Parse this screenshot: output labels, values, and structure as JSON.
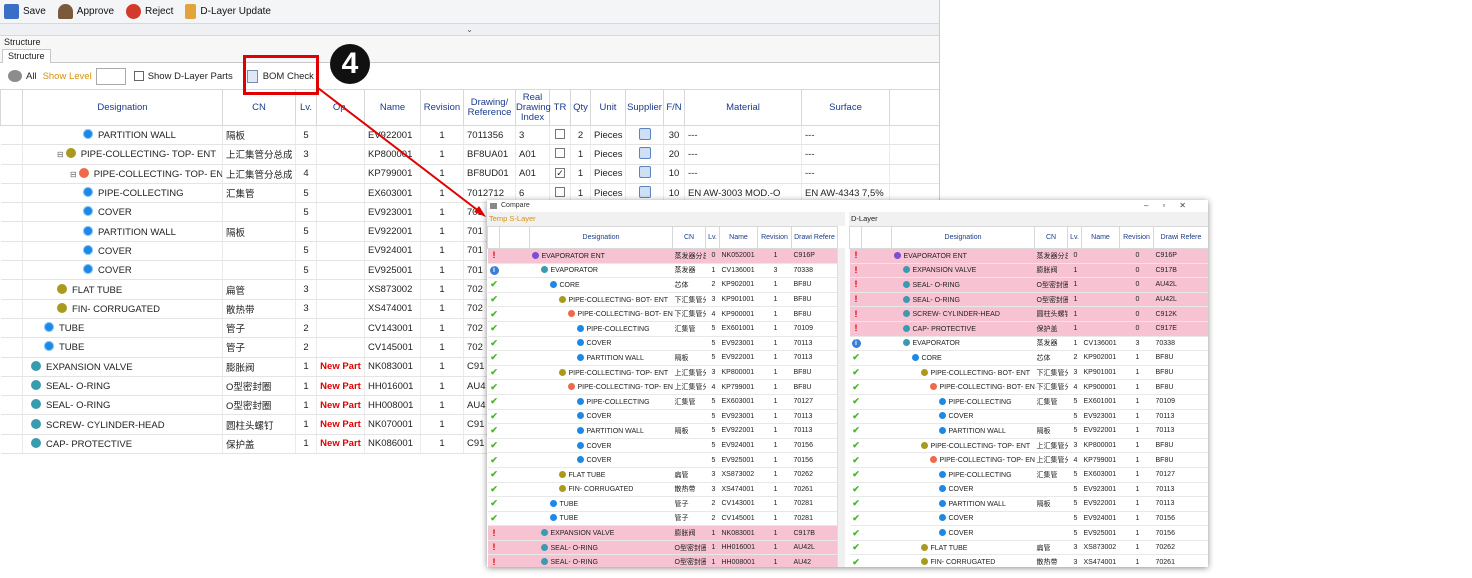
{
  "toolbar": {
    "save": "Save",
    "approve": "Approve",
    "reject": "Reject",
    "dlayer_update": "D-Layer Update"
  },
  "section_label": "Structure",
  "tab_structure": "Structure",
  "filters": {
    "all": "All",
    "show_level": "Show Level",
    "show_dlayer": "Show D-Layer Parts",
    "bom_check": "BOM Check"
  },
  "step_badge": "4",
  "main_columns": [
    "Designation",
    "CN",
    "Lv.",
    "Op.",
    "Name",
    "Revision",
    "Drawing/ Reference",
    "Real Drawing Index",
    "TR",
    "Qty",
    "Unit",
    "Supplier",
    "F/N",
    "Material",
    "Surface"
  ],
  "main_rows": [
    {
      "indent": 4,
      "pm": "",
      "icon": "blue",
      "des": "PARTITION WALL",
      "cn": "隔板",
      "lv": "5",
      "op": "",
      "name": "EV922001",
      "rev": "1",
      "draw": "7011356",
      "idx": "3",
      "tr": "empty",
      "qty": "2",
      "unit": "Pieces",
      "sup": true,
      "fn": "30",
      "mat": "---",
      "surf": "---"
    },
    {
      "indent": 2,
      "pm": "⊟",
      "icon": "olive",
      "des": "PIPE-COLLECTING- TOP- ENT",
      "cn": "上汇集管分总成",
      "lv": "3",
      "op": "",
      "name": "KP800001",
      "rev": "1",
      "draw": "BF8UA01",
      "idx": "A01",
      "tr": "empty",
      "qty": "1",
      "unit": "Pieces",
      "sup": true,
      "fn": "20",
      "mat": "---",
      "surf": "---"
    },
    {
      "indent": 3,
      "pm": "⊟",
      "icon": "red",
      "des": "PIPE-COLLECTING- TOP- ENT",
      "cn": "上汇集管分总成",
      "lv": "4",
      "op": "",
      "name": "KP799001",
      "rev": "1",
      "draw": "BF8UD01",
      "idx": "A01",
      "tr": "checked",
      "qty": "1",
      "unit": "Pieces",
      "sup": true,
      "fn": "10",
      "mat": "---",
      "surf": "---"
    },
    {
      "indent": 4,
      "pm": "",
      "icon": "blue",
      "des": "PIPE-COLLECTING",
      "cn": "汇集管",
      "lv": "5",
      "op": "",
      "name": "EX603001",
      "rev": "1",
      "draw": "7012712",
      "idx": "6",
      "tr": "empty",
      "qty": "1",
      "unit": "Pieces",
      "sup": true,
      "fn": "10",
      "mat": "EN AW-3003 MOD.-O",
      "surf": "EN AW-4343 7,5%"
    },
    {
      "indent": 4,
      "pm": "",
      "icon": "blue",
      "des": "COVER",
      "cn": "",
      "lv": "5",
      "op": "",
      "name": "EV923001",
      "rev": "1",
      "draw": "701",
      "idx": "",
      "tr": "",
      "qty": "",
      "unit": "",
      "sup": false,
      "fn": "",
      "mat": "",
      "surf": ""
    },
    {
      "indent": 4,
      "pm": "",
      "icon": "blue",
      "des": "PARTITION WALL",
      "cn": "隔板",
      "lv": "5",
      "op": "",
      "name": "EV922001",
      "rev": "1",
      "draw": "701",
      "idx": "",
      "tr": "",
      "qty": "",
      "unit": "",
      "sup": false,
      "fn": "",
      "mat": "",
      "surf": ""
    },
    {
      "indent": 4,
      "pm": "",
      "icon": "blue",
      "des": "COVER",
      "cn": "",
      "lv": "5",
      "op": "",
      "name": "EV924001",
      "rev": "1",
      "draw": "701",
      "idx": "",
      "tr": "",
      "qty": "",
      "unit": "",
      "sup": false,
      "fn": "",
      "mat": "",
      "surf": ""
    },
    {
      "indent": 4,
      "pm": "",
      "icon": "blue",
      "des": "COVER",
      "cn": "",
      "lv": "5",
      "op": "",
      "name": "EV925001",
      "rev": "1",
      "draw": "701",
      "idx": "",
      "tr": "",
      "qty": "",
      "unit": "",
      "sup": false,
      "fn": "",
      "mat": "",
      "surf": ""
    },
    {
      "indent": 2,
      "pm": "",
      "icon": "olive",
      "des": "FLAT TUBE",
      "cn": "扁管",
      "lv": "3",
      "op": "",
      "name": "XS873002",
      "rev": "1",
      "draw": "702",
      "idx": "",
      "tr": "",
      "qty": "",
      "unit": "",
      "sup": false,
      "fn": "",
      "mat": "",
      "surf": ""
    },
    {
      "indent": 2,
      "pm": "",
      "icon": "olive",
      "des": "FIN- CORRUGATED",
      "cn": "散热带",
      "lv": "3",
      "op": "",
      "name": "XS474001",
      "rev": "1",
      "draw": "702",
      "idx": "",
      "tr": "",
      "qty": "",
      "unit": "",
      "sup": false,
      "fn": "",
      "mat": "",
      "surf": ""
    },
    {
      "indent": 1,
      "pm": "",
      "icon": "blue",
      "des": "TUBE",
      "cn": "管子",
      "lv": "2",
      "op": "",
      "name": "CV143001",
      "rev": "1",
      "draw": "702",
      "idx": "",
      "tr": "",
      "qty": "",
      "unit": "",
      "sup": false,
      "fn": "",
      "mat": "",
      "surf": ""
    },
    {
      "indent": 1,
      "pm": "",
      "icon": "blue",
      "des": "TUBE",
      "cn": "管子",
      "lv": "2",
      "op": "",
      "name": "CV145001",
      "rev": "1",
      "draw": "702",
      "idx": "",
      "tr": "",
      "qty": "",
      "unit": "",
      "sup": false,
      "fn": "",
      "mat": "",
      "surf": ""
    },
    {
      "indent": 0,
      "pm": "",
      "icon": "teal",
      "des": "EXPANSION VALVE",
      "cn": "膨胀阀",
      "lv": "1",
      "op": "New Part",
      "name": "NK083001",
      "rev": "1",
      "draw": "C91",
      "idx": "",
      "tr": "",
      "qty": "",
      "unit": "",
      "sup": false,
      "fn": "",
      "mat": "",
      "surf": ""
    },
    {
      "indent": 0,
      "pm": "",
      "icon": "teal",
      "des": "SEAL- O-RING",
      "cn": "O型密封圈",
      "lv": "1",
      "op": "New Part",
      "name": "HH016001",
      "rev": "1",
      "draw": "AU4",
      "idx": "",
      "tr": "",
      "qty": "",
      "unit": "",
      "sup": false,
      "fn": "",
      "mat": "",
      "surf": ""
    },
    {
      "indent": 0,
      "pm": "",
      "icon": "teal",
      "des": "SEAL- O-RING",
      "cn": "O型密封圈",
      "lv": "1",
      "op": "New Part",
      "name": "HH008001",
      "rev": "1",
      "draw": "AU4",
      "idx": "",
      "tr": "",
      "qty": "",
      "unit": "",
      "sup": false,
      "fn": "",
      "mat": "",
      "surf": ""
    },
    {
      "indent": 0,
      "pm": "",
      "icon": "teal",
      "des": "SCREW- CYLINDER-HEAD",
      "cn": "圆柱头螺钉",
      "lv": "1",
      "op": "New Part",
      "name": "NK070001",
      "rev": "1",
      "draw": "C91",
      "idx": "",
      "tr": "",
      "qty": "",
      "unit": "",
      "sup": false,
      "fn": "",
      "mat": "",
      "surf": ""
    },
    {
      "indent": 0,
      "pm": "",
      "icon": "teal",
      "des": "CAP- PROTECTIVE",
      "cn": "保护盖",
      "lv": "1",
      "op": "New Part",
      "name": "NK086001",
      "rev": "1",
      "draw": "C91",
      "idx": "",
      "tr": "",
      "qty": "",
      "unit": "",
      "sup": false,
      "fn": "",
      "mat": "",
      "surf": ""
    }
  ],
  "compare": {
    "window_title": "Compare",
    "left_label": "Temp S-Layer",
    "right_label": "D-Layer",
    "columns": [
      "Designation",
      "CN",
      "Lv.",
      "Name",
      "Revision",
      "Drawi Refere"
    ],
    "left_rows": [
      {
        "st": "bad",
        "pink": true,
        "indent": 0,
        "icon": "purple",
        "des": "EVAPORATOR ENT",
        "cn": "蒸发器分总成",
        "lv": "0",
        "name": "NK052001",
        "rev": "1",
        "draw": "C916P"
      },
      {
        "st": "info",
        "pink": false,
        "indent": 1,
        "icon": "teal",
        "des": "EVAPORATOR",
        "cn": "蒸发器",
        "lv": "1",
        "name": "CV136001",
        "rev": "3",
        "draw": "70338"
      },
      {
        "st": "ok",
        "pink": false,
        "indent": 2,
        "icon": "blue",
        "des": "CORE",
        "cn": "芯体",
        "lv": "2",
        "name": "KP902001",
        "rev": "1",
        "draw": "BF8U"
      },
      {
        "st": "ok",
        "pink": false,
        "indent": 3,
        "icon": "olive",
        "des": "PIPE-COLLECTING- BOT- ENT",
        "cn": "下汇集管分总成",
        "lv": "3",
        "name": "KP901001",
        "rev": "1",
        "draw": "BF8U"
      },
      {
        "st": "ok",
        "pink": false,
        "indent": 4,
        "icon": "red",
        "des": "PIPE-COLLECTING- BOT- ENT",
        "cn": "下汇集管分总成",
        "lv": "4",
        "name": "KP900001",
        "rev": "1",
        "draw": "BF8U"
      },
      {
        "st": "ok",
        "pink": false,
        "indent": 5,
        "icon": "blue",
        "des": "PIPE-COLLECTING",
        "cn": "汇集管",
        "lv": "5",
        "name": "EX601001",
        "rev": "1",
        "draw": "70109"
      },
      {
        "st": "ok",
        "pink": false,
        "indent": 5,
        "icon": "blue",
        "des": "COVER",
        "cn": "",
        "lv": "5",
        "name": "EV923001",
        "rev": "1",
        "draw": "70113"
      },
      {
        "st": "ok",
        "pink": false,
        "indent": 5,
        "icon": "blue",
        "des": "PARTITION WALL",
        "cn": "隔板",
        "lv": "5",
        "name": "EV922001",
        "rev": "1",
        "draw": "70113"
      },
      {
        "st": "ok",
        "pink": false,
        "indent": 3,
        "icon": "olive",
        "des": "PIPE-COLLECTING- TOP- ENT",
        "cn": "上汇集管分总成",
        "lv": "3",
        "name": "KP800001",
        "rev": "1",
        "draw": "BF8U"
      },
      {
        "st": "ok",
        "pink": false,
        "indent": 4,
        "icon": "red",
        "des": "PIPE-COLLECTING- TOP- ENT",
        "cn": "上汇集管分总成",
        "lv": "4",
        "name": "KP799001",
        "rev": "1",
        "draw": "BF8U"
      },
      {
        "st": "ok",
        "pink": false,
        "indent": 5,
        "icon": "blue",
        "des": "PIPE-COLLECTING",
        "cn": "汇集管",
        "lv": "5",
        "name": "EX603001",
        "rev": "1",
        "draw": "70127"
      },
      {
        "st": "ok",
        "pink": false,
        "indent": 5,
        "icon": "blue",
        "des": "COVER",
        "cn": "",
        "lv": "5",
        "name": "EV923001",
        "rev": "1",
        "draw": "70113"
      },
      {
        "st": "ok",
        "pink": false,
        "indent": 5,
        "icon": "blue",
        "des": "PARTITION WALL",
        "cn": "隔板",
        "lv": "5",
        "name": "EV922001",
        "rev": "1",
        "draw": "70113"
      },
      {
        "st": "ok",
        "pink": false,
        "indent": 5,
        "icon": "blue",
        "des": "COVER",
        "cn": "",
        "lv": "5",
        "name": "EV924001",
        "rev": "1",
        "draw": "70156"
      },
      {
        "st": "ok",
        "pink": false,
        "indent": 5,
        "icon": "blue",
        "des": "COVER",
        "cn": "",
        "lv": "5",
        "name": "EV925001",
        "rev": "1",
        "draw": "70156"
      },
      {
        "st": "ok",
        "pink": false,
        "indent": 3,
        "icon": "olive",
        "des": "FLAT TUBE",
        "cn": "扁管",
        "lv": "3",
        "name": "XS873002",
        "rev": "1",
        "draw": "70262"
      },
      {
        "st": "ok",
        "pink": false,
        "indent": 3,
        "icon": "olive",
        "des": "FIN- CORRUGATED",
        "cn": "散热带",
        "lv": "3",
        "name": "XS474001",
        "rev": "1",
        "draw": "70261"
      },
      {
        "st": "ok",
        "pink": false,
        "indent": 2,
        "icon": "blue",
        "des": "TUBE",
        "cn": "管子",
        "lv": "2",
        "name": "CV143001",
        "rev": "1",
        "draw": "70281"
      },
      {
        "st": "ok",
        "pink": false,
        "indent": 2,
        "icon": "blue",
        "des": "TUBE",
        "cn": "管子",
        "lv": "2",
        "name": "CV145001",
        "rev": "1",
        "draw": "70281"
      },
      {
        "st": "bad",
        "pink": true,
        "indent": 1,
        "icon": "teal",
        "des": "EXPANSION VALVE",
        "cn": "膨胀阀",
        "lv": "1",
        "name": "NK083001",
        "rev": "1",
        "draw": "C917B"
      },
      {
        "st": "bad",
        "pink": true,
        "indent": 1,
        "icon": "teal",
        "des": "SEAL- O-RING",
        "cn": "O型密封圈",
        "lv": "1",
        "name": "HH016001",
        "rev": "1",
        "draw": "AU42L"
      },
      {
        "st": "bad",
        "pink": true,
        "indent": 1,
        "icon": "teal",
        "des": "SEAL- O-RING",
        "cn": "O型密封圈",
        "lv": "1",
        "name": "HH008001",
        "rev": "1",
        "draw": "AU42"
      }
    ],
    "right_rows": [
      {
        "st": "bad",
        "pink": true,
        "indent": 0,
        "icon": "purple",
        "des": "EVAPORATOR ENT",
        "cn": "蒸发器分总成",
        "lv": "0",
        "name": "",
        "rev": "0",
        "draw": "C916P"
      },
      {
        "st": "bad",
        "pink": true,
        "indent": 1,
        "icon": "teal",
        "des": "EXPANSION VALVE",
        "cn": "膨胀阀",
        "lv": "1",
        "name": "",
        "rev": "0",
        "draw": "C917B"
      },
      {
        "st": "bad",
        "pink": true,
        "indent": 1,
        "icon": "teal",
        "des": "SEAL- O-RING",
        "cn": "O型密封圈",
        "lv": "1",
        "name": "",
        "rev": "0",
        "draw": "AU42L"
      },
      {
        "st": "bad",
        "pink": true,
        "indent": 1,
        "icon": "teal",
        "des": "SEAL- O-RING",
        "cn": "O型密封圈",
        "lv": "1",
        "name": "",
        "rev": "0",
        "draw": "AU42L"
      },
      {
        "st": "bad",
        "pink": true,
        "indent": 1,
        "icon": "teal",
        "des": "SCREW- CYLINDER-HEAD",
        "cn": "圆柱头螺钉",
        "lv": "1",
        "name": "",
        "rev": "0",
        "draw": "C912K"
      },
      {
        "st": "bad",
        "pink": true,
        "indent": 1,
        "icon": "teal",
        "des": "CAP- PROTECTIVE",
        "cn": "保护盖",
        "lv": "1",
        "name": "",
        "rev": "0",
        "draw": "C917E"
      },
      {
        "st": "info",
        "pink": false,
        "indent": 1,
        "icon": "teal",
        "des": "EVAPORATOR",
        "cn": "蒸发器",
        "lv": "1",
        "name": "CV136001",
        "rev": "3",
        "draw": "70338"
      },
      {
        "st": "ok",
        "pink": false,
        "indent": 2,
        "icon": "blue",
        "des": "CORE",
        "cn": "芯体",
        "lv": "2",
        "name": "KP902001",
        "rev": "1",
        "draw": "BF8U"
      },
      {
        "st": "ok",
        "pink": false,
        "indent": 3,
        "icon": "olive",
        "des": "PIPE-COLLECTING- BOT- ENT",
        "cn": "下汇集管分总成",
        "lv": "3",
        "name": "KP901001",
        "rev": "1",
        "draw": "BF8U"
      },
      {
        "st": "ok",
        "pink": false,
        "indent": 4,
        "icon": "red",
        "des": "PIPE-COLLECTING- BOT- ENT",
        "cn": "下汇集管分总成",
        "lv": "4",
        "name": "KP900001",
        "rev": "1",
        "draw": "BF8U"
      },
      {
        "st": "ok",
        "pink": false,
        "indent": 5,
        "icon": "blue",
        "des": "PIPE-COLLECTING",
        "cn": "汇集管",
        "lv": "5",
        "name": "EX601001",
        "rev": "1",
        "draw": "70109"
      },
      {
        "st": "ok",
        "pink": false,
        "indent": 5,
        "icon": "blue",
        "des": "COVER",
        "cn": "",
        "lv": "5",
        "name": "EV923001",
        "rev": "1",
        "draw": "70113"
      },
      {
        "st": "ok",
        "pink": false,
        "indent": 5,
        "icon": "blue",
        "des": "PARTITION WALL",
        "cn": "隔板",
        "lv": "5",
        "name": "EV922001",
        "rev": "1",
        "draw": "70113"
      },
      {
        "st": "ok",
        "pink": false,
        "indent": 3,
        "icon": "olive",
        "des": "PIPE-COLLECTING- TOP- ENT",
        "cn": "上汇集管分总成",
        "lv": "3",
        "name": "KP800001",
        "rev": "1",
        "draw": "BF8U"
      },
      {
        "st": "ok",
        "pink": false,
        "indent": 4,
        "icon": "red",
        "des": "PIPE-COLLECTING- TOP- ENT",
        "cn": "上汇集管分总成",
        "lv": "4",
        "name": "KP799001",
        "rev": "1",
        "draw": "BF8U"
      },
      {
        "st": "ok",
        "pink": false,
        "indent": 5,
        "icon": "blue",
        "des": "PIPE-COLLECTING",
        "cn": "汇集管",
        "lv": "5",
        "name": "EX603001",
        "rev": "1",
        "draw": "70127"
      },
      {
        "st": "ok",
        "pink": false,
        "indent": 5,
        "icon": "blue",
        "des": "COVER",
        "cn": "",
        "lv": "5",
        "name": "EV923001",
        "rev": "1",
        "draw": "70113"
      },
      {
        "st": "ok",
        "pink": false,
        "indent": 5,
        "icon": "blue",
        "des": "PARTITION WALL",
        "cn": "隔板",
        "lv": "5",
        "name": "EV922001",
        "rev": "1",
        "draw": "70113"
      },
      {
        "st": "ok",
        "pink": false,
        "indent": 5,
        "icon": "blue",
        "des": "COVER",
        "cn": "",
        "lv": "5",
        "name": "EV924001",
        "rev": "1",
        "draw": "70156"
      },
      {
        "st": "ok",
        "pink": false,
        "indent": 5,
        "icon": "blue",
        "des": "COVER",
        "cn": "",
        "lv": "5",
        "name": "EV925001",
        "rev": "1",
        "draw": "70156"
      },
      {
        "st": "ok",
        "pink": false,
        "indent": 3,
        "icon": "olive",
        "des": "FLAT TUBE",
        "cn": "扁管",
        "lv": "3",
        "name": "XS873002",
        "rev": "1",
        "draw": "70262"
      },
      {
        "st": "ok",
        "pink": false,
        "indent": 3,
        "icon": "olive",
        "des": "FIN- CORRUGATED",
        "cn": "散热带",
        "lv": "3",
        "name": "XS474001",
        "rev": "1",
        "draw": "70261"
      }
    ]
  },
  "colors": {
    "header_text": "#1a3a8a",
    "new_part": "#e00000",
    "highlight_box": "#e00000",
    "diff_row": "#f7c3d2",
    "ok": "#49b72a"
  }
}
